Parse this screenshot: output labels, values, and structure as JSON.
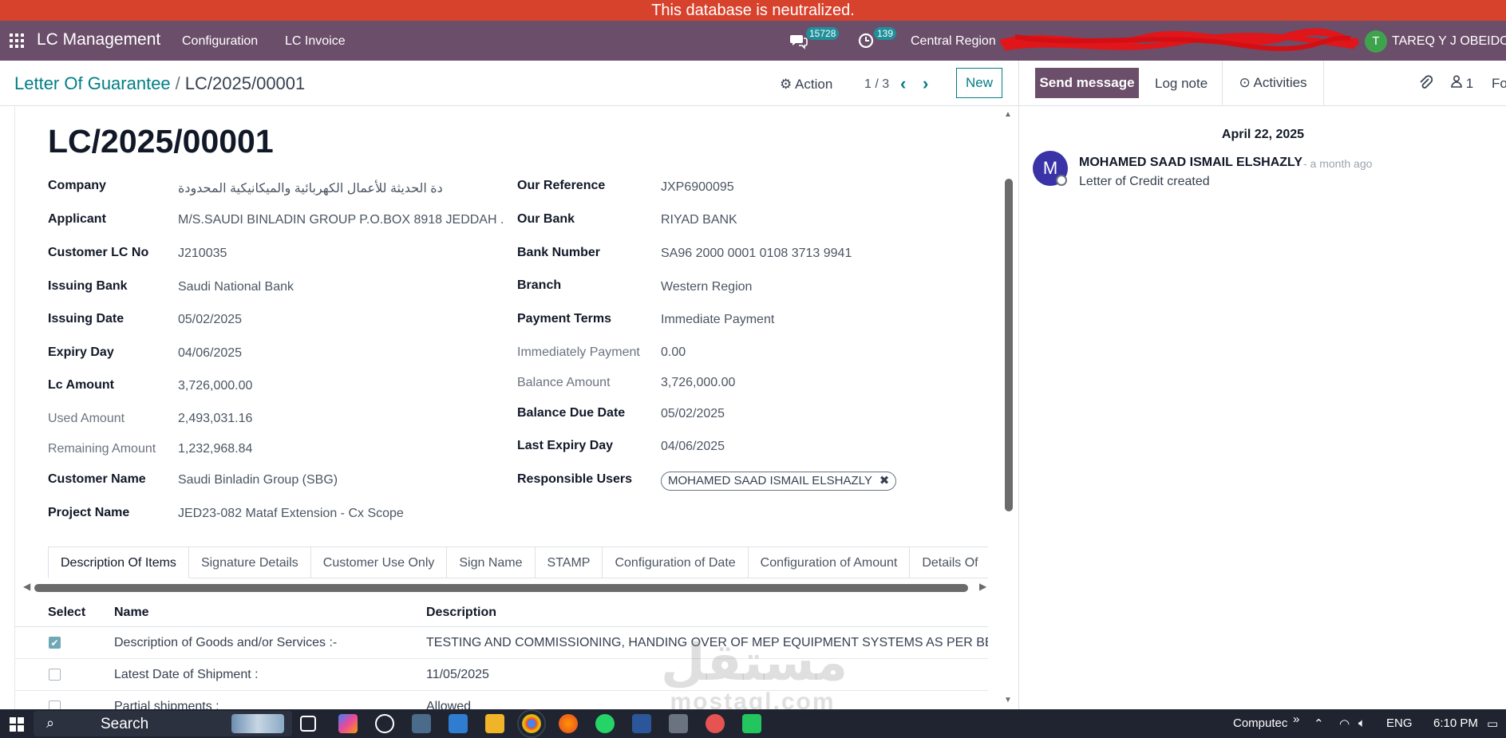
{
  "banner": {
    "text": "This database is neutralized."
  },
  "navbar": {
    "app_name": "LC Management",
    "menu": [
      "Configuration",
      "LC Invoice"
    ],
    "messages_count": "15728",
    "activities_count": "139",
    "company": "Central Region",
    "user_initial": "T",
    "user_name": "TAREQ Y J OBEIDO E"
  },
  "control_panel": {
    "breadcrumb_parent": "Letter Of Guarantee",
    "breadcrumb_current": "LC/2025/00001",
    "action_label": "Action",
    "pager": "1 / 3",
    "new_label": "New"
  },
  "record": {
    "title": "LC/2025/00001",
    "left_fields": [
      {
        "label": "Company",
        "value": "دة الحديثة للأعمال الكهربائية والميكانيكية المحدودة"
      },
      {
        "label": "Applicant",
        "value": "M/S.SAUDI BINLADIN GROUP P.O.BOX 8918 JEDDAH ."
      },
      {
        "label": "Customer LC No",
        "value": "J210035"
      },
      {
        "label": "Issuing Bank",
        "value": "Saudi National Bank"
      },
      {
        "label": "Issuing Date",
        "value": "05/02/2025"
      },
      {
        "label": "Expiry Day",
        "value": "04/06/2025"
      },
      {
        "label": "Lc Amount",
        "value": "3,726,000.00"
      },
      {
        "label": "Used Amount",
        "value": "2,493,031.16"
      },
      {
        "label": "Remaining Amount",
        "value": "1,232,968.84"
      },
      {
        "label": "Customer Name",
        "value": "Saudi Binladin Group (SBG)"
      },
      {
        "label": "Project Name",
        "value": "JED23-082 Mataf Extension - Cx Scope"
      }
    ],
    "right_fields": [
      {
        "label": "Our Reference",
        "value": "JXP6900095"
      },
      {
        "label": "Our Bank",
        "value": "RIYAD BANK"
      },
      {
        "label": "Bank Number",
        "value": "SA96 2000 0001 0108 3713 9941"
      },
      {
        "label": "Branch",
        "value": "Western Region"
      },
      {
        "label": "Payment Terms",
        "value": "Immediate Payment"
      },
      {
        "label": "Immediately Payment",
        "value": "0.00"
      },
      {
        "label": "Balance Amount",
        "value": "3,726,000.00"
      },
      {
        "label": "Balance Due Date",
        "value": "05/02/2025"
      },
      {
        "label": "Last Expiry Day",
        "value": "04/06/2025"
      },
      {
        "label": "Responsible Users",
        "value": "MOHAMED SAAD ISMAIL ELSHAZLY"
      }
    ],
    "tabs": [
      "Description Of Items",
      "Signature Details",
      "Customer Use Only",
      "Sign Name",
      "STAMP",
      "Configuration of Date",
      "Configuration of Amount",
      "Details Of"
    ],
    "table": {
      "headers": [
        "Select",
        "Name",
        "Description"
      ],
      "rows": [
        {
          "checked": true,
          "name": "Description of Goods and/or Services :-",
          "description": "TESTING AND COMMISSIONING, HANDING OVER OF MEP EQUIPMENT SYSTEMS AS PER BENEFIC"
        },
        {
          "checked": false,
          "name": "Latest Date of Shipment :",
          "description": "11/05/2025"
        },
        {
          "checked": false,
          "name": "Partial shipments :",
          "description": "Allowed"
        }
      ]
    }
  },
  "chatter": {
    "send_message": "Send message",
    "log_note": "Log note",
    "activities": "Activities",
    "followers_count": "1",
    "follow": "Fo",
    "date": "April 22, 2025",
    "message": {
      "avatar_initial": "M",
      "author": "MOHAMED SAAD ISMAIL ELSHAZLY",
      "time": "- a month ago",
      "body": "Letter of Credit created"
    }
  },
  "watermark": {
    "arabic": "مستقل",
    "latin": "mostaql.com"
  },
  "taskbar": {
    "search": "Search",
    "tray_user": "Computec",
    "language": "ENG",
    "time": "6:10 PM"
  },
  "colors": {
    "banner": "#d7422d",
    "navbar": "#6b4e6a",
    "accent": "#017e84",
    "badge": "#1f8f9a",
    "user_avatar": "#3fa34d",
    "message_avatar": "#3a33a8"
  }
}
